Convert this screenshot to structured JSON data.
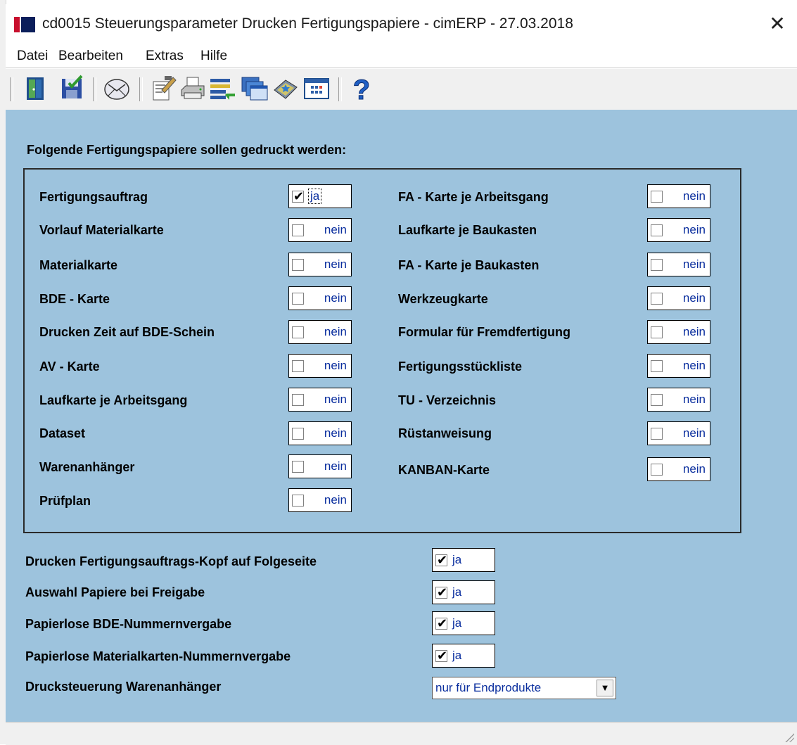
{
  "window": {
    "title": "cd0015 Steuerungsparameter Drucken Fertigungspapiere - cimERP - 27.03.2018",
    "close_symbol": "✕"
  },
  "menu": [
    "Datei",
    "Bearbeiten",
    "Extras",
    "Hilfe"
  ],
  "toolbar": {
    "icons": [
      "exit-door-icon",
      "save-icon",
      "mail-icon",
      "edit-document-icon",
      "print-icon",
      "list-transfer-icon",
      "windows-stack-icon",
      "book-icon",
      "calendar-icon",
      "help-icon"
    ],
    "help_symbol": "?"
  },
  "form": {
    "heading": "Folgende Fertigungspapiere sollen gedruckt werden:",
    "left_options": [
      {
        "label": "Fertigungsauftrag",
        "checked": true,
        "value": "ja"
      },
      {
        "label": "Vorlauf Materialkarte",
        "checked": false,
        "value": "nein"
      },
      {
        "label": "Materialkarte",
        "checked": false,
        "value": "nein"
      },
      {
        "label": "BDE - Karte",
        "checked": false,
        "value": "nein"
      },
      {
        "label": "Drucken Zeit auf BDE-Schein",
        "checked": false,
        "value": "nein"
      },
      {
        "label": "AV - Karte",
        "checked": false,
        "value": "nein"
      },
      {
        "label": "Laufkarte je Arbeitsgang",
        "checked": false,
        "value": "nein"
      },
      {
        "label": "Dataset",
        "checked": false,
        "value": "nein"
      },
      {
        "label": "Warenanhänger",
        "checked": false,
        "value": "nein"
      },
      {
        "label": "Prüfplan",
        "checked": false,
        "value": "nein"
      }
    ],
    "right_options": [
      {
        "label": "FA - Karte je Arbeitsgang",
        "checked": false,
        "value": "nein"
      },
      {
        "label": "Laufkarte je Baukasten",
        "checked": false,
        "value": "nein"
      },
      {
        "label": "FA - Karte je Baukasten",
        "checked": false,
        "value": "nein"
      },
      {
        "label": "Werkzeugkarte",
        "checked": false,
        "value": "nein"
      },
      {
        "label": "Formular für Fremdfertigung",
        "checked": false,
        "value": "nein"
      },
      {
        "label": "Fertigungsstückliste",
        "checked": false,
        "value": "nein"
      },
      {
        "label": "TU - Verzeichnis",
        "checked": false,
        "value": "nein"
      },
      {
        "label": "Rüstanweisung",
        "checked": false,
        "value": "nein"
      },
      {
        "label": "KANBAN-Karte",
        "checked": false,
        "value": "nein"
      }
    ],
    "settings": [
      {
        "label": "Drucken Fertigungsauftrags-Kopf auf Folgeseite",
        "checked": true,
        "value": "ja"
      },
      {
        "label": "Auswahl Papiere bei Freigabe",
        "checked": true,
        "value": "ja"
      },
      {
        "label": "Papierlose BDE-Nummernvergabe",
        "checked": true,
        "value": "ja"
      },
      {
        "label": "Papierlose Materialkarten-Nummernvergabe",
        "checked": true,
        "value": "ja"
      }
    ],
    "dropdown": {
      "label": "Drucksteuerung Warenanhänger",
      "value": "nur für Endprodukte",
      "arrow": "▼"
    }
  },
  "check_mark": "✔",
  "colors": {
    "client_bg": "#9dc3dd",
    "value_text": "#0a2e9e"
  }
}
